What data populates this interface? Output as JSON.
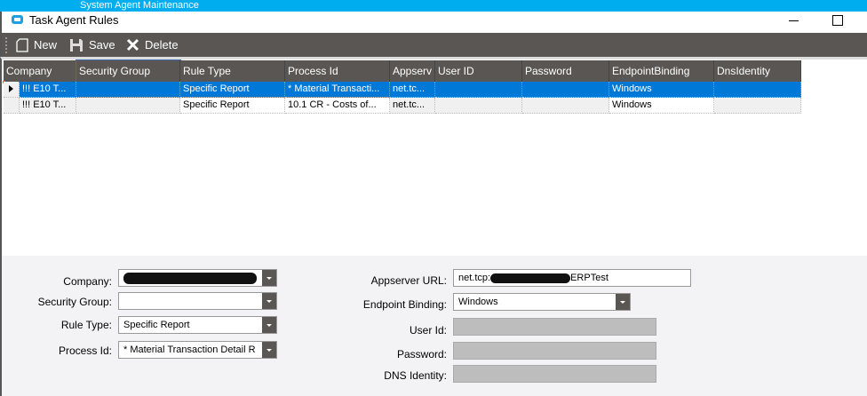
{
  "background_window": {
    "title": "System Agent Maintenance"
  },
  "window": {
    "title": "Task Agent Rules"
  },
  "toolbar": {
    "new_label": "New",
    "save_label": "Save",
    "delete_label": "Delete"
  },
  "grid": {
    "columns": [
      "Company",
      "Security Group",
      "Rule Type",
      "Process Id",
      "Appserv",
      "User ID",
      "Password",
      "EndpointBinding",
      "DnsIdentity"
    ],
    "rows": [
      {
        "selected": true,
        "cells": [
          "!!! E10 T...",
          "",
          "Specific Report",
          "* Material Transacti...",
          "net.tc...",
          "",
          "",
          "Windows",
          ""
        ]
      },
      {
        "selected": false,
        "cells": [
          "!!! E10 T...",
          "",
          "Specific Report",
          "10.1 CR - Costs of...",
          "net.tc...",
          "",
          "",
          "Windows",
          ""
        ]
      }
    ]
  },
  "form": {
    "company": {
      "label": "Company:",
      "value": ""
    },
    "security_group": {
      "label": "Security Group:",
      "value": ""
    },
    "rule_type": {
      "label": "Rule Type:",
      "value": "Specific Report"
    },
    "process_id": {
      "label": "Process Id:",
      "value": "* Material Transaction Detail R"
    },
    "appserver_url": {
      "label": "Appserver URL:",
      "value_prefix": "net.tcp:",
      "value_suffix": "ERPTest"
    },
    "endpoint_binding": {
      "label": "Endpoint Binding:",
      "value": "Windows"
    },
    "user_id": {
      "label": "User Id:",
      "value": ""
    },
    "password": {
      "label": "Password:",
      "value": ""
    },
    "dns_identity": {
      "label": "DNS Identity:",
      "value": ""
    }
  },
  "colors": {
    "toolbar": "#595653",
    "selection": "#0078d7",
    "title_strip": "#00adef"
  }
}
